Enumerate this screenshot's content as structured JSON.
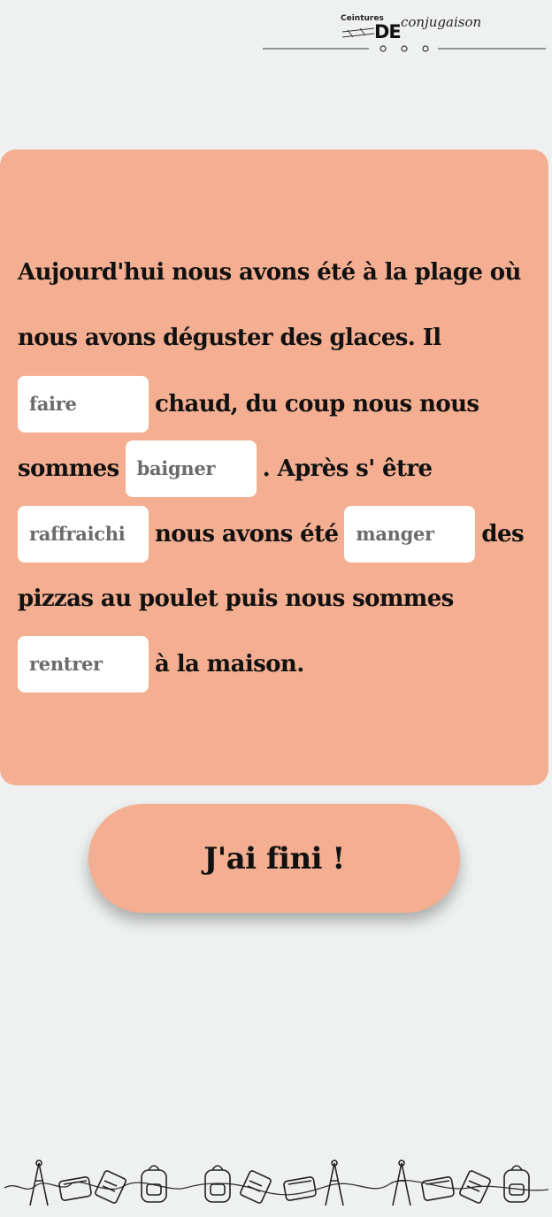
{
  "header": {
    "logo_small": "Ceintures",
    "logo_big": "DE",
    "logo_script": "conjugaison"
  },
  "exercise": {
    "line1": "Aujourd'hui nous avons été à la plage où",
    "line2": "nous avons déguster des glaces. Il",
    "line3_after": "chaud, du coup nous nous",
    "line4_before": "sommes",
    "line4_after": ". Après s' être",
    "line5_mid": "nous avons été",
    "line5_after": "des",
    "line6": "pizzas au poulet puis nous sommes",
    "line7_after": "à la maison.",
    "blanks": {
      "faire": "faire",
      "baigner": "baigner",
      "raffraichi": "raffraichi",
      "manger": "manger",
      "rentrer": "rentrer"
    }
  },
  "finish_button": "J'ai fini !",
  "icons": {
    "footer": [
      "compass-icon",
      "pencil-case-icon",
      "notebook-icon",
      "backpack-icon"
    ]
  },
  "colors": {
    "background": "#eff1f0",
    "card": "#f4ae91",
    "input_bg": "#ffffff",
    "placeholder": "#6b6b6b",
    "text": "#111111"
  }
}
